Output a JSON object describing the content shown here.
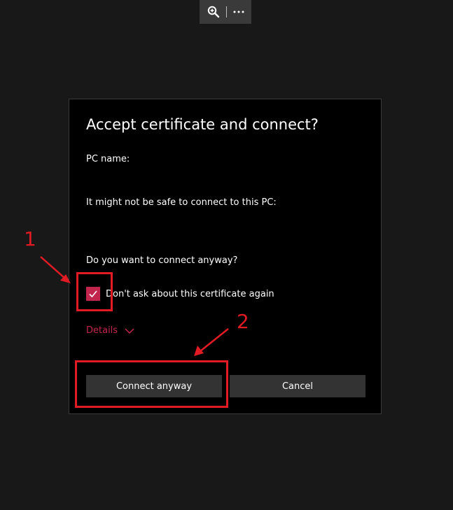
{
  "toolbar": {
    "zoom_icon": "zoom-in-icon",
    "more_icon": "more-icon"
  },
  "dialog": {
    "title": "Accept certificate and connect?",
    "pc_name_label": "PC name:",
    "warning_text": "It might not be safe to connect to this PC:",
    "question": "Do you want to connect anyway?",
    "checkbox_label": "Don't ask about this certificate again",
    "checkbox_checked": true,
    "details_label": "Details",
    "connect_button": "Connect anyway",
    "cancel_button": "Cancel"
  },
  "annotations": {
    "step1": "1",
    "step2": "2"
  },
  "colors": {
    "accent": "#c2264c",
    "annotation": "#e01b24",
    "dialog_bg": "#000000",
    "page_bg": "#181818",
    "button_bg": "#333333"
  }
}
